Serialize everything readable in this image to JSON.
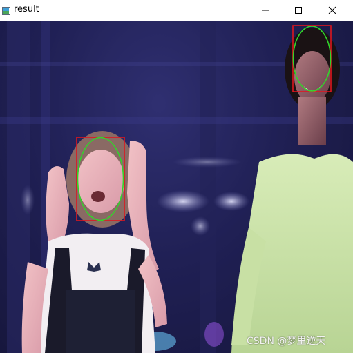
{
  "window": {
    "title": "result",
    "icons": {
      "app": "image-window-icon",
      "minimize": "minimize-icon",
      "maximize": "maximize-icon",
      "close": "close-icon"
    }
  },
  "image": {
    "description_colors": {
      "face_box": "#e0161e",
      "face_ellipse": "#31d62a"
    },
    "watermark": "CSDN @梦里逆天"
  }
}
